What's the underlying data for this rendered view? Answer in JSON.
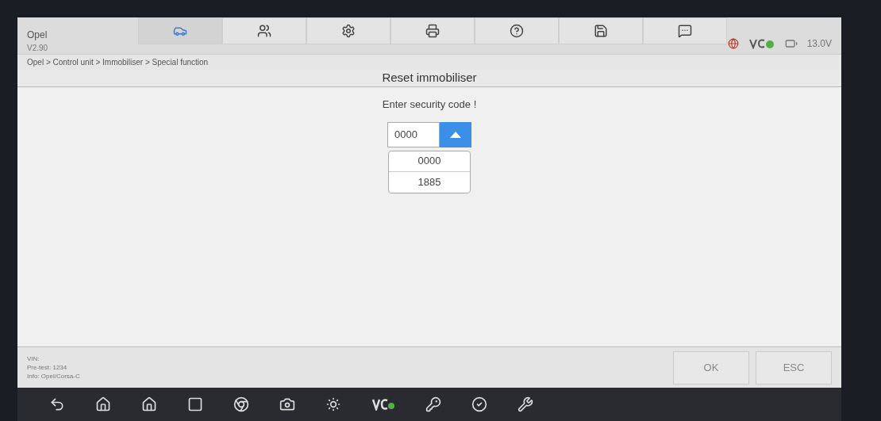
{
  "header": {
    "brand": "Opel",
    "version": "V2.90"
  },
  "toolbar": [
    {
      "selected": true
    },
    {
      "selected": false
    },
    {
      "selected": false
    },
    {
      "selected": false
    },
    {
      "selected": false
    },
    {
      "selected": false
    },
    {
      "selected": false
    }
  ],
  "status": {
    "voltage": "13.0V",
    "vci_connected": true
  },
  "breadcrumb": "Opel > Control unit > Immobiliser > Special function",
  "title": "Reset immobiliser",
  "prompt": "Enter security code !",
  "code_dropdown": {
    "value": "0000",
    "expanded": true,
    "options": [
      "0000",
      "1885"
    ]
  },
  "info": [
    "VIN:",
    "Pre-test: 1234",
    "Info: Opel/Corsa-C"
  ],
  "buttons": [
    "OK",
    "ESC"
  ]
}
